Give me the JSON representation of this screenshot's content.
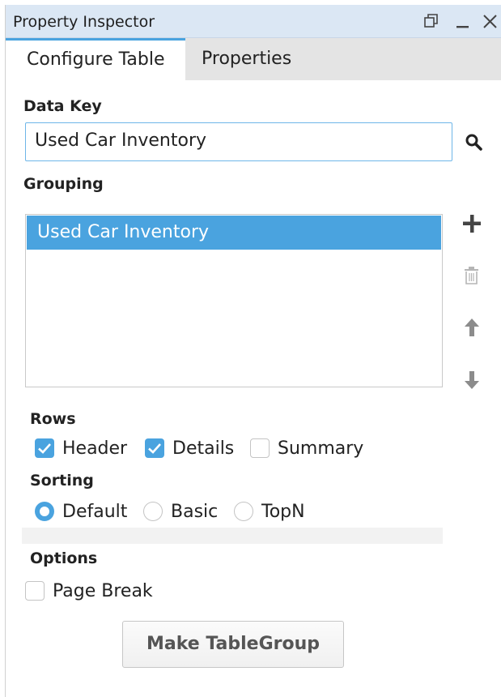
{
  "window": {
    "title": "Property Inspector"
  },
  "tabs": [
    {
      "label": "Configure Table",
      "active": true
    },
    {
      "label": "Properties",
      "active": false
    }
  ],
  "data_key": {
    "label": "Data Key",
    "value": "Used Car Inventory"
  },
  "grouping": {
    "label": "Grouping",
    "items": [
      {
        "label": "Used Car Inventory",
        "selected": true
      }
    ]
  },
  "rows": {
    "label": "Rows",
    "options": [
      {
        "label": "Header",
        "checked": true
      },
      {
        "label": "Details",
        "checked": true
      },
      {
        "label": "Summary",
        "checked": false
      }
    ]
  },
  "sorting": {
    "label": "Sorting",
    "options": [
      {
        "label": "Default",
        "selected": true
      },
      {
        "label": "Basic",
        "selected": false
      },
      {
        "label": "TopN",
        "selected": false
      }
    ]
  },
  "options": {
    "label": "Options",
    "page_break": {
      "label": "Page Break",
      "checked": false
    }
  },
  "make_button": {
    "label": "Make TableGroup"
  },
  "colors": {
    "accent": "#4aa3df",
    "titlebar": "#dbe7f4"
  }
}
